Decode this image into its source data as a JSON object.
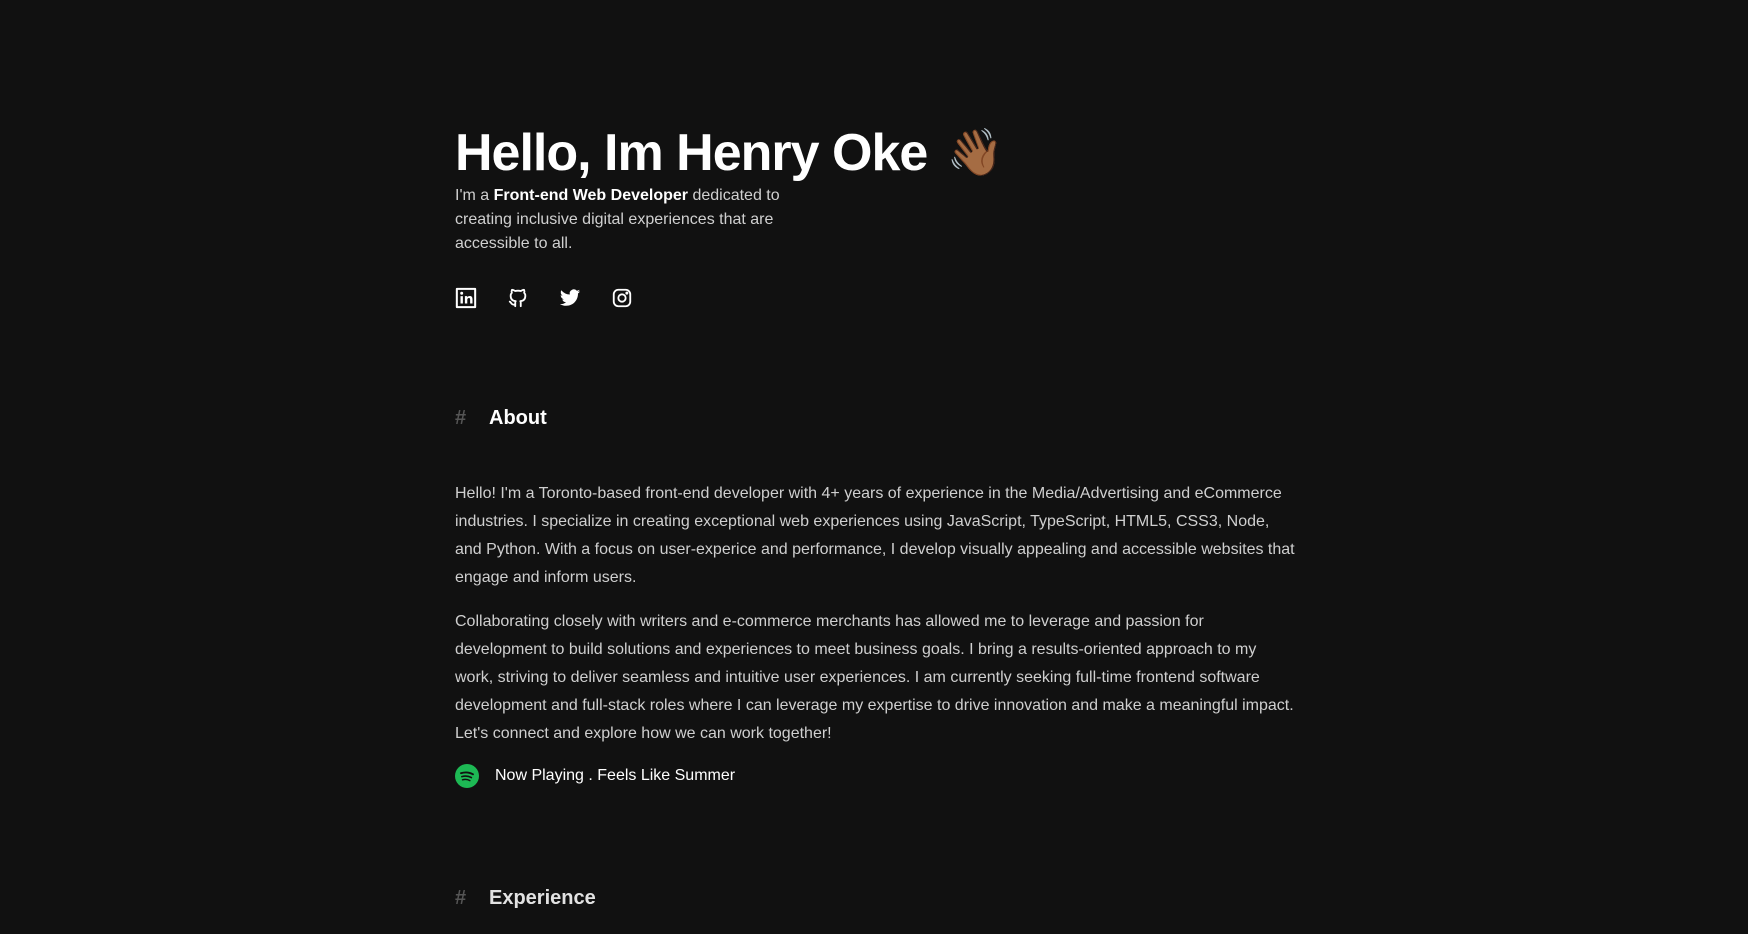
{
  "hero": {
    "title": "Hello, Im Henry Oke",
    "wave_emoji": "👋🏾",
    "intro_prefix": "I'm a ",
    "intro_role": "Front-end Web Developer",
    "intro_suffix": " dedicated to creating inclusive digital experiences that are accessible to all."
  },
  "socials": [
    {
      "icon": "linkedin-icon"
    },
    {
      "icon": "github-icon"
    },
    {
      "icon": "twitter-icon"
    },
    {
      "icon": "instagram-icon"
    }
  ],
  "about": {
    "hash": "#",
    "heading": "About",
    "paragraph_1": "Hello! I'm a Toronto-based front-end developer with 4+ years of experience in the Media/Advertising and eCommerce industries. I specialize in creating exceptional web experiences using JavaScript, TypeScript, HTML5, CSS3, Node, and Python. With a focus on user-experice and performance, I develop visually appealing and accessible websites that engage and inform users.",
    "paragraph_2": "Collaborating closely with writers and e-commerce merchants has allowed me to leverage and passion for development to build solutions and experiences to meet business goals. I bring a results-oriented approach to my work, striving to deliver seamless and intuitive user experiences. I am currently seeking full-time frontend software development and full-stack roles where I can leverage my expertise to drive innovation and make a meaningful impact. Let's connect and explore how we can work together!"
  },
  "now_playing": {
    "icon": "spotify-icon",
    "text": "Now Playing . Feels Like Summer"
  },
  "experience": {
    "hash": "#",
    "heading": "Experience"
  },
  "colors": {
    "background": "#111111",
    "text": "#d6d6d6",
    "heading": "#ffffff",
    "hash": "#555555",
    "spotify_green": "#1DB954"
  }
}
